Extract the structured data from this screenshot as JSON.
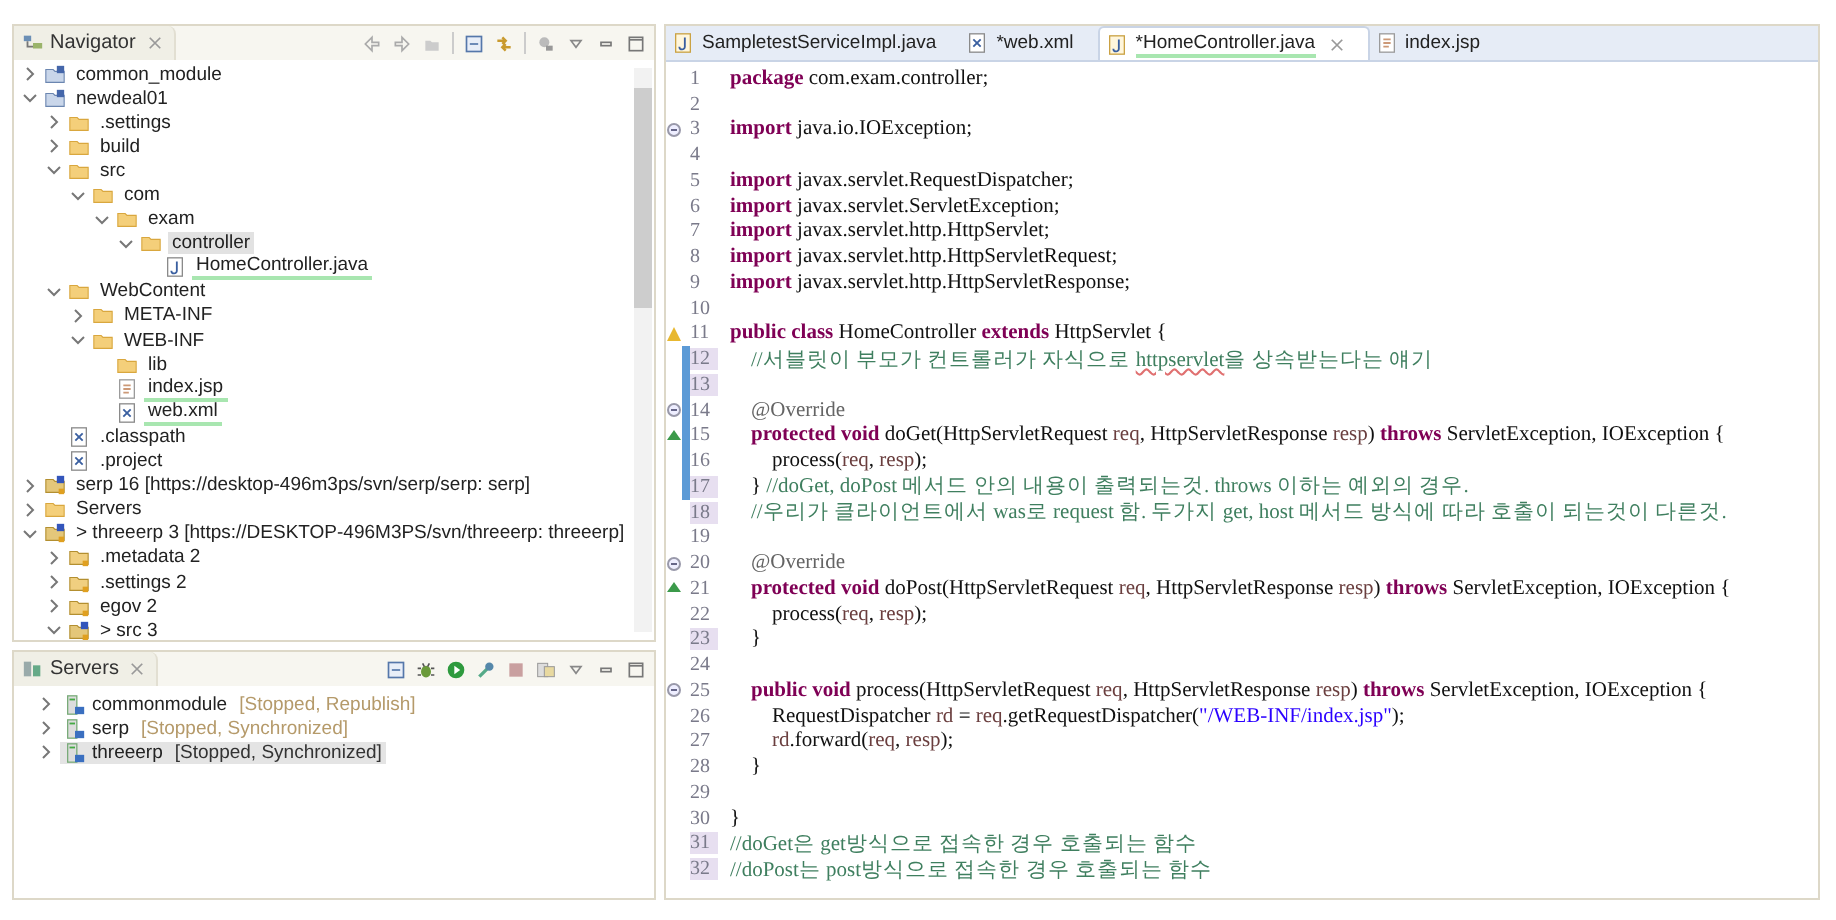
{
  "navigator": {
    "title": "Navigator",
    "tree": [
      {
        "label": "common_module",
        "kind": "project",
        "expanded": false,
        "selected": false,
        "marked": false
      },
      {
        "label": "newdeal01",
        "kind": "project",
        "expanded": true,
        "selected": false,
        "marked": false,
        "children": [
          {
            "label": ".settings",
            "kind": "folder",
            "expanded": false,
            "selected": false,
            "marked": false
          },
          {
            "label": "build",
            "kind": "folder",
            "expanded": false,
            "selected": false,
            "marked": false
          },
          {
            "label": "src",
            "kind": "folder",
            "expanded": true,
            "selected": false,
            "marked": false,
            "children": [
              {
                "label": "com",
                "kind": "folder",
                "expanded": true,
                "selected": false,
                "marked": false,
                "children": [
                  {
                    "label": "exam",
                    "kind": "folder",
                    "expanded": true,
                    "selected": false,
                    "marked": false,
                    "children": [
                      {
                        "label": "controller",
                        "kind": "folder",
                        "expanded": true,
                        "selected": true,
                        "marked": false,
                        "children": [
                          {
                            "label": "HomeController.java",
                            "kind": "java",
                            "selected": false,
                            "marked": true
                          }
                        ]
                      }
                    ]
                  }
                ]
              }
            ]
          },
          {
            "label": "WebContent",
            "kind": "folder",
            "expanded": true,
            "selected": false,
            "marked": false,
            "children": [
              {
                "label": "META-INF",
                "kind": "folder",
                "expanded": false,
                "selected": false,
                "marked": false
              },
              {
                "label": "WEB-INF",
                "kind": "folder",
                "expanded": true,
                "selected": false,
                "marked": false,
                "children": [
                  {
                    "label": "lib",
                    "kind": "folder",
                    "selected": false,
                    "marked": false
                  },
                  {
                    "label": "index.jsp",
                    "kind": "jsp",
                    "selected": false,
                    "marked": true
                  },
                  {
                    "label": "web.xml",
                    "kind": "xml",
                    "selected": false,
                    "marked": true
                  }
                ]
              }
            ]
          },
          {
            "label": ".classpath",
            "kind": "xml",
            "selected": false,
            "marked": false
          },
          {
            "label": ".project",
            "kind": "xml",
            "selected": false,
            "marked": false
          }
        ]
      },
      {
        "label": "serp 16 [https://desktop-496m3ps/svn/serp/serp: serp]",
        "kind": "repo",
        "expanded": false,
        "selected": false,
        "marked": false
      },
      {
        "label": "Servers",
        "kind": "folder",
        "expanded": false,
        "selected": false,
        "marked": false
      },
      {
        "label": "> threeerp 3 [https://DESKTOP-496M3PS/svn/threeerp: threeerp]",
        "kind": "repo",
        "expanded": true,
        "selected": false,
        "marked": false,
        "children": [
          {
            "label": ".metadata 2",
            "kind": "repofolder",
            "expanded": false,
            "selected": false,
            "marked": false
          },
          {
            "label": ".settings 2",
            "kind": "repofolder",
            "expanded": false,
            "selected": false,
            "marked": false
          },
          {
            "label": "egov 2",
            "kind": "repofolder",
            "expanded": false,
            "selected": false,
            "marked": false
          },
          {
            "label": "> src 3",
            "kind": "repo",
            "expanded": true,
            "selected": false,
            "marked": false
          }
        ]
      }
    ]
  },
  "servers": {
    "title": "Servers",
    "items": [
      {
        "name": "commonmodule",
        "status": "[Stopped, Republish]",
        "selected": false
      },
      {
        "name": "serp",
        "status": "[Stopped, Synchronized]",
        "selected": false
      },
      {
        "name": "threeerp",
        "status": "[Stopped, Synchronized]",
        "selected": true
      }
    ]
  },
  "editor": {
    "tabs": [
      {
        "label": "SampletestServiceImpl.java",
        "kind": "java",
        "selected": false,
        "marked": false
      },
      {
        "label": "*web.xml",
        "kind": "xml",
        "selected": false,
        "marked": false
      },
      {
        "label": "*HomeController.java",
        "kind": "java",
        "selected": true,
        "marked": true
      },
      {
        "label": "index.jsp",
        "kind": "jsp",
        "selected": false,
        "marked": false
      }
    ],
    "lines": [
      {
        "number": "1",
        "kind": "plain",
        "changed": false,
        "range": false,
        "tokens": [
          {
            "kind": "keyword",
            "text": "package"
          },
          {
            "kind": "plain",
            "text": " com.exam.controller;"
          }
        ]
      },
      {
        "number": "2",
        "kind": "plain",
        "changed": false,
        "range": false
      },
      {
        "number": "3",
        "kind": "fold",
        "changed": false,
        "range": false,
        "tokens": [
          {
            "kind": "keyword",
            "text": "import"
          },
          {
            "kind": "plain",
            "text": " java.io.IOException;"
          }
        ]
      },
      {
        "number": "4",
        "kind": "plain",
        "changed": false,
        "range": false
      },
      {
        "number": "5",
        "kind": "plain",
        "changed": false,
        "range": false,
        "tokens": [
          {
            "kind": "keyword",
            "text": "import"
          },
          {
            "kind": "plain",
            "text": " javax.servlet.RequestDispatcher;"
          }
        ]
      },
      {
        "number": "6",
        "kind": "plain",
        "changed": false,
        "range": false,
        "tokens": [
          {
            "kind": "keyword",
            "text": "import"
          },
          {
            "kind": "plain",
            "text": " javax.servlet.ServletException;"
          }
        ]
      },
      {
        "number": "7",
        "kind": "plain",
        "changed": false,
        "range": false,
        "tokens": [
          {
            "kind": "keyword",
            "text": "import"
          },
          {
            "kind": "plain",
            "text": " javax.servlet.http.HttpServlet;"
          }
        ]
      },
      {
        "number": "8",
        "kind": "plain",
        "changed": false,
        "range": false,
        "tokens": [
          {
            "kind": "keyword",
            "text": "import"
          },
          {
            "kind": "plain",
            "text": " javax.servlet.http.HttpServletRequest;"
          }
        ]
      },
      {
        "number": "9",
        "kind": "plain",
        "changed": false,
        "range": false,
        "tokens": [
          {
            "kind": "keyword",
            "text": "import"
          },
          {
            "kind": "plain",
            "text": " javax.servlet.http.HttpServletResponse;"
          }
        ]
      },
      {
        "number": "10",
        "kind": "plain",
        "changed": false,
        "range": false
      },
      {
        "number": "11",
        "kind": "warning",
        "changed": false,
        "range": false,
        "tokens": [
          {
            "kind": "keyword",
            "text": "public class"
          },
          {
            "kind": "plain",
            "text": " HomeController "
          },
          {
            "kind": "keyword",
            "text": "extends"
          },
          {
            "kind": "plain",
            "text": " HttpServlet {"
          }
        ]
      },
      {
        "number": "12",
        "kind": "plain",
        "changed": true,
        "range": true,
        "tokens": [
          {
            "kind": "comment",
            "text": "    //서블릿이 부모가 컨트롤러가 자식으로 "
          },
          {
            "kind": "spelling",
            "text": "httpservlet"
          },
          {
            "kind": "comment",
            "text": "을 상속받는다는 얘기"
          }
        ]
      },
      {
        "number": "13",
        "kind": "plain",
        "changed": true,
        "range": true
      },
      {
        "number": "14",
        "kind": "fold",
        "changed": false,
        "range": true,
        "tokens": [
          {
            "kind": "annotation",
            "text": "    @Override"
          }
        ]
      },
      {
        "number": "15",
        "kind": "override",
        "changed": false,
        "range": true,
        "tokens": [
          {
            "kind": "keyword",
            "text": "    protected void"
          },
          {
            "kind": "plain",
            "text": " doGet(HttpServletRequest "
          },
          {
            "kind": "param",
            "text": "req"
          },
          {
            "kind": "plain",
            "text": ", HttpServletResponse "
          },
          {
            "kind": "param",
            "text": "resp"
          },
          {
            "kind": "plain",
            "text": ") "
          },
          {
            "kind": "keyword",
            "text": "throws"
          },
          {
            "kind": "plain",
            "text": " ServletException, IOException {"
          }
        ]
      },
      {
        "number": "16",
        "kind": "plain",
        "changed": false,
        "range": true,
        "tokens": [
          {
            "kind": "plain",
            "text": "        process("
          },
          {
            "kind": "param",
            "text": "req"
          },
          {
            "kind": "plain",
            "text": ", "
          },
          {
            "kind": "param",
            "text": "resp"
          },
          {
            "kind": "plain",
            "text": ");"
          }
        ]
      },
      {
        "number": "17",
        "kind": "plain",
        "changed": true,
        "range": true,
        "tokens": [
          {
            "kind": "plain",
            "text": "    } "
          },
          {
            "kind": "comment",
            "text": "//doGet, doPost 메서드 안의 내용이 출력되는것. throws 이하는 예외의 경우."
          }
        ]
      },
      {
        "number": "18",
        "kind": "plain",
        "changed": true,
        "range": false,
        "tokens": [
          {
            "kind": "comment",
            "text": "    //우리가 클라이언트에서 was로 request 함. 두가지 get, host 메서드 방식에 따라 호출이 되는것이 다른것."
          }
        ]
      },
      {
        "number": "19",
        "kind": "plain",
        "changed": false,
        "range": false
      },
      {
        "number": "20",
        "kind": "fold",
        "changed": false,
        "range": false,
        "tokens": [
          {
            "kind": "annotation",
            "text": "    @Override"
          }
        ]
      },
      {
        "number": "21",
        "kind": "override",
        "changed": false,
        "range": false,
        "tokens": [
          {
            "kind": "keyword",
            "text": "    protected void"
          },
          {
            "kind": "plain",
            "text": " doPost(HttpServletRequest "
          },
          {
            "kind": "param",
            "text": "req"
          },
          {
            "kind": "plain",
            "text": ", HttpServletResponse "
          },
          {
            "kind": "param",
            "text": "resp"
          },
          {
            "kind": "plain",
            "text": ") "
          },
          {
            "kind": "keyword",
            "text": "throws"
          },
          {
            "kind": "plain",
            "text": " ServletException, IOException {"
          }
        ]
      },
      {
        "number": "22",
        "kind": "plain",
        "changed": false,
        "range": false,
        "tokens": [
          {
            "kind": "plain",
            "text": "        process("
          },
          {
            "kind": "param",
            "text": "req"
          },
          {
            "kind": "plain",
            "text": ", "
          },
          {
            "kind": "param",
            "text": "resp"
          },
          {
            "kind": "plain",
            "text": ");"
          }
        ]
      },
      {
        "number": "23",
        "kind": "plain",
        "changed": true,
        "range": false,
        "tokens": [
          {
            "kind": "plain",
            "text": "    }"
          }
        ]
      },
      {
        "number": "24",
        "kind": "plain",
        "changed": false,
        "range": false
      },
      {
        "number": "25",
        "kind": "fold",
        "changed": false,
        "range": false,
        "tokens": [
          {
            "kind": "keyword",
            "text": "    public void"
          },
          {
            "kind": "plain",
            "text": " process(HttpServletRequest "
          },
          {
            "kind": "param",
            "text": "req"
          },
          {
            "kind": "plain",
            "text": ", HttpServletResponse "
          },
          {
            "kind": "param",
            "text": "resp"
          },
          {
            "kind": "plain",
            "text": ") "
          },
          {
            "kind": "keyword",
            "text": "throws"
          },
          {
            "kind": "plain",
            "text": " ServletException, IOException {"
          }
        ]
      },
      {
        "number": "26",
        "kind": "plain",
        "changed": false,
        "range": false,
        "tokens": [
          {
            "kind": "plain",
            "text": "        RequestDispatcher "
          },
          {
            "kind": "param",
            "text": "rd"
          },
          {
            "kind": "plain",
            "text": " = "
          },
          {
            "kind": "param",
            "text": "req"
          },
          {
            "kind": "plain",
            "text": ".getRequestDispatcher("
          },
          {
            "kind": "string",
            "text": "\"/WEB-INF/index.jsp\""
          },
          {
            "kind": "plain",
            "text": ");"
          }
        ]
      },
      {
        "number": "27",
        "kind": "plain",
        "changed": false,
        "range": false,
        "tokens": [
          {
            "kind": "param",
            "text": "        rd"
          },
          {
            "kind": "plain",
            "text": ".forward("
          },
          {
            "kind": "param",
            "text": "req"
          },
          {
            "kind": "plain",
            "text": ", "
          },
          {
            "kind": "param",
            "text": "resp"
          },
          {
            "kind": "plain",
            "text": ");"
          }
        ]
      },
      {
        "number": "28",
        "kind": "plain",
        "changed": false,
        "range": false,
        "tokens": [
          {
            "kind": "plain",
            "text": "    }"
          }
        ]
      },
      {
        "number": "29",
        "kind": "plain",
        "changed": false,
        "range": false
      },
      {
        "number": "30",
        "kind": "plain",
        "changed": false,
        "range": false,
        "tokens": [
          {
            "kind": "plain",
            "text": "}"
          }
        ]
      },
      {
        "number": "31",
        "kind": "plain",
        "changed": true,
        "range": false,
        "tokens": [
          {
            "kind": "comment",
            "text": "//doGet은 get방식으로 접속한 경우 호출되는 함수"
          }
        ]
      },
      {
        "number": "32",
        "kind": "plain",
        "changed": true,
        "range": false,
        "tokens": [
          {
            "kind": "comment",
            "text": "//doPost는 post방식으로 접속한 경우 호출되는 함수"
          }
        ]
      }
    ]
  }
}
